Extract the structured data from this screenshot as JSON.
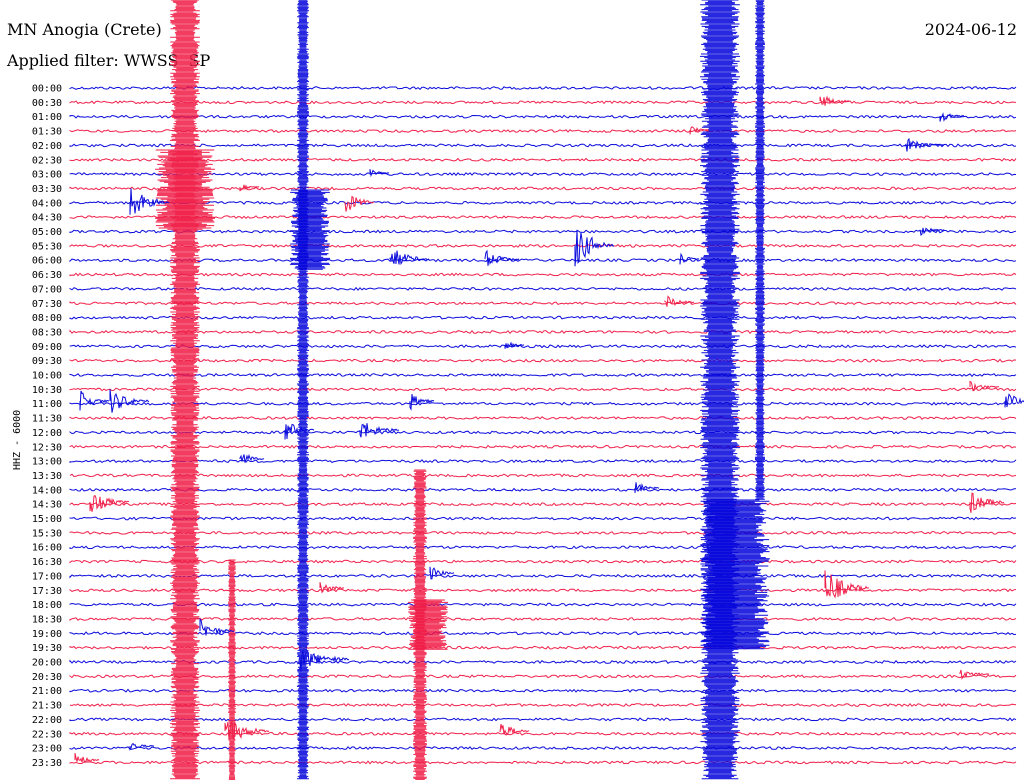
{
  "header": {
    "station": "MN Anogia (Crete)",
    "date": "2024-06-12",
    "filter_text": "Applied filter: WWSS  SP"
  },
  "axis": {
    "y_label": "HHZ - 6000"
  },
  "colors": {
    "trace_a": "#0a0adc",
    "trace_b": "#f0204a"
  },
  "rows": [
    "00:00",
    "00:30",
    "01:00",
    "01:30",
    "02:00",
    "02:30",
    "03:00",
    "03:30",
    "04:00",
    "04:30",
    "05:00",
    "05:30",
    "06:00",
    "06:30",
    "07:00",
    "07:30",
    "08:00",
    "08:30",
    "09:00",
    "09:30",
    "10:00",
    "10:30",
    "11:00",
    "11:30",
    "12:00",
    "12:30",
    "13:00",
    "13:30",
    "14:00",
    "14:30",
    "15:00",
    "15:30",
    "16:00",
    "16:30",
    "17:00",
    "17:30",
    "18:00",
    "18:30",
    "19:00",
    "19:30",
    "20:00",
    "20:30",
    "21:00",
    "21:30",
    "22:00",
    "22:30",
    "23:00",
    "23:30"
  ]
}
